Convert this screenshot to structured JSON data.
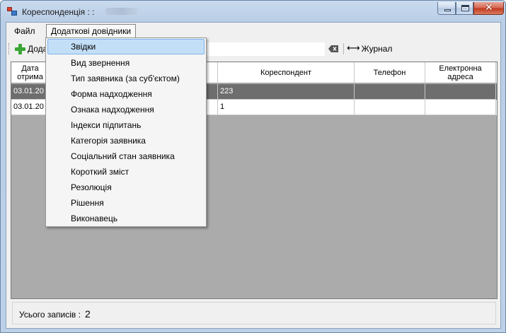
{
  "window": {
    "title": "Кореспонденція : :"
  },
  "menubar": {
    "file": "Файл",
    "dictionaries": "Додаткові довідники"
  },
  "toolbar": {
    "add_label": "Дода",
    "journal_label": "Журнал",
    "search_value": ""
  },
  "grid": {
    "headers": [
      "Дата отрима",
      "",
      "Кореспондент",
      "Телефон",
      "Електронна адреса"
    ],
    "rows": [
      {
        "date": "03.01.20",
        "hidden": "",
        "correspondent": "223",
        "phone": "",
        "email": ""
      },
      {
        "date": "03.01.20",
        "hidden": "",
        "correspondent": "1",
        "phone": "",
        "email": ""
      }
    ]
  },
  "status": {
    "label": "Усього записів :",
    "count": "2"
  },
  "dropdown": {
    "items": [
      "Звідки",
      "Вид звернення",
      "Тип заявника (за суб'єктом)",
      "Форма надходження",
      "Ознака надходження",
      "Індекси підпитань",
      "Категорія заявника",
      "Соціальний стан заявника",
      "Короткий зміст",
      "Резолюція",
      "Рішення",
      "Виконавець"
    ]
  },
  "icons": [
    "app-icon",
    "minimize-icon",
    "maximize-icon",
    "close-icon",
    "plus-icon",
    "clear-icon",
    "arrows-icon"
  ]
}
